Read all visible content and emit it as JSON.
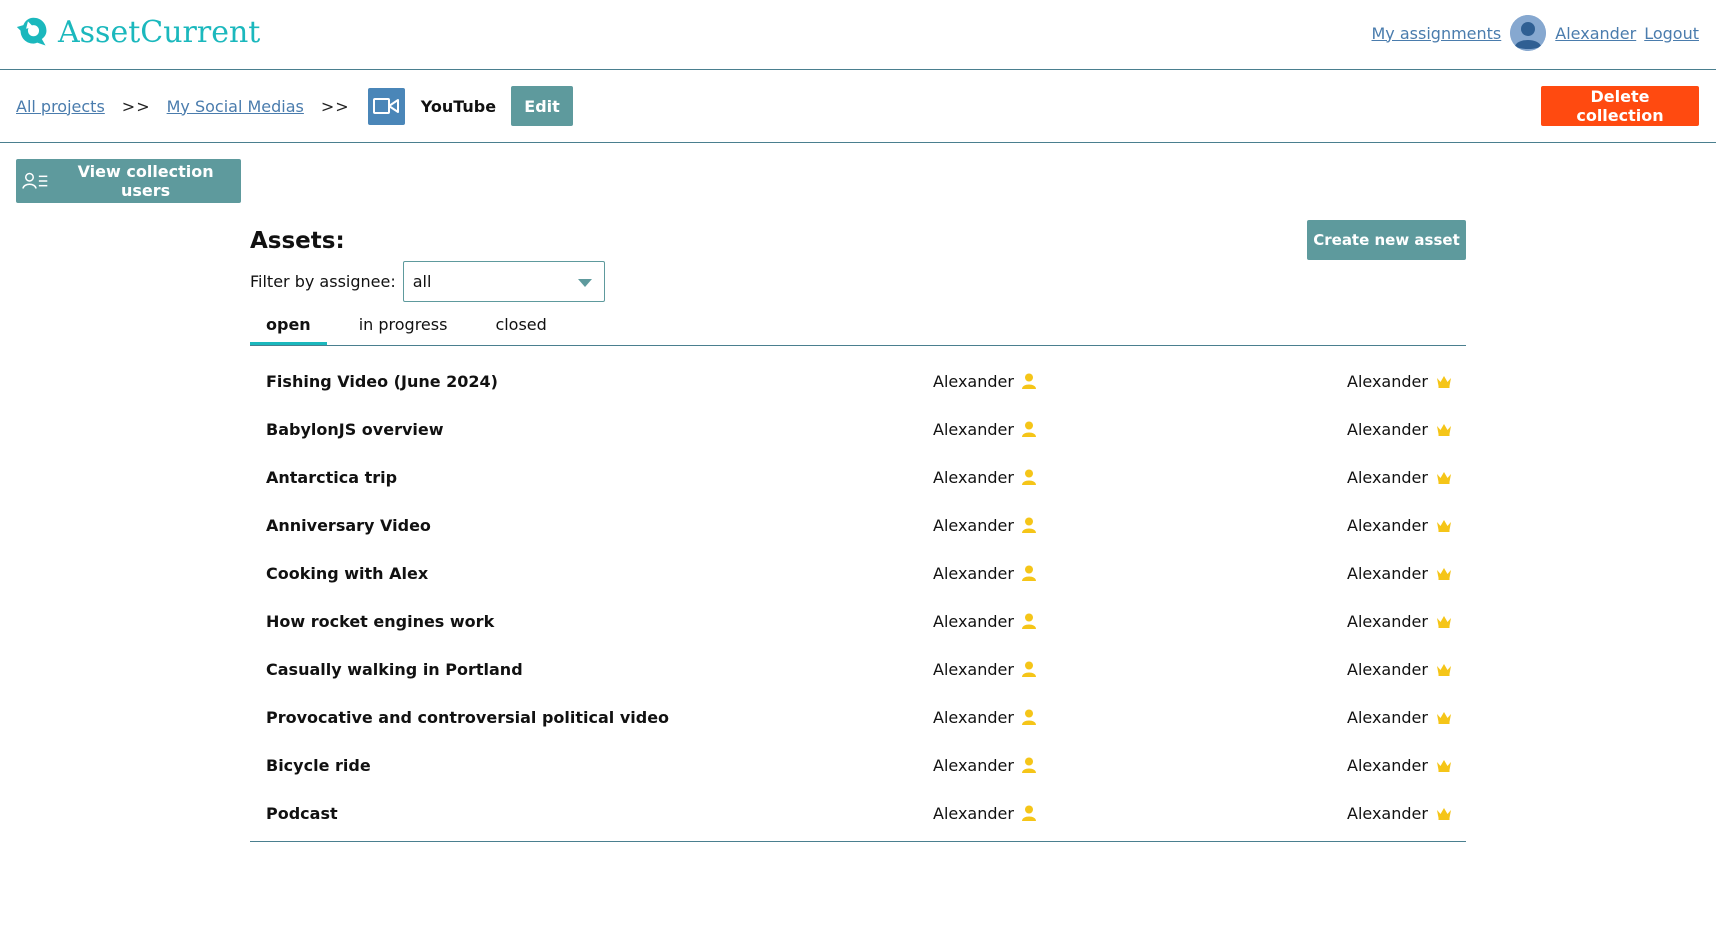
{
  "app": {
    "name": "AssetCurrent"
  },
  "header": {
    "my_assignments": "My assignments",
    "user_name": "Alexander",
    "logout": "Logout"
  },
  "breadcrumb": {
    "all_projects": "All projects",
    "sep1": ">>",
    "project": "My Social Medias",
    "sep2": ">>",
    "collection": "YouTube",
    "collection_icon": "video-camera-icon",
    "edit_label": "Edit"
  },
  "actions": {
    "delete_collection": "Delete collection",
    "view_collection_users": "View collection users"
  },
  "assets": {
    "title": "Assets:",
    "create_label": "Create new asset",
    "filter_label": "Filter by assignee:",
    "filter_value": "all",
    "tabs": [
      {
        "label": "open",
        "active": true
      },
      {
        "label": "in progress",
        "active": false
      },
      {
        "label": "closed",
        "active": false
      }
    ],
    "items": [
      {
        "name": "Fishing Video (June 2024)",
        "assignee": "Alexander",
        "owner": "Alexander"
      },
      {
        "name": "BabylonJS overview",
        "assignee": "Alexander",
        "owner": "Alexander"
      },
      {
        "name": "Antarctica trip",
        "assignee": "Alexander",
        "owner": "Alexander"
      },
      {
        "name": "Anniversary Video",
        "assignee": "Alexander",
        "owner": "Alexander"
      },
      {
        "name": "Cooking with Alex",
        "assignee": "Alexander",
        "owner": "Alexander"
      },
      {
        "name": "How rocket engines work",
        "assignee": "Alexander",
        "owner": "Alexander"
      },
      {
        "name": "Casually walking in Portland",
        "assignee": "Alexander",
        "owner": "Alexander"
      },
      {
        "name": "Provocative and controversial political video",
        "assignee": "Alexander",
        "owner": "Alexander"
      },
      {
        "name": "Bicycle ride",
        "assignee": "Alexander",
        "owner": "Alexander"
      },
      {
        "name": "Podcast",
        "assignee": "Alexander",
        "owner": "Alexander"
      }
    ]
  },
  "colors": {
    "accent": "#1bb8bd",
    "button": "#5e9a9d",
    "danger": "#ff4a10",
    "link": "#4a7cad",
    "icon_yellow": "#f5c518"
  }
}
